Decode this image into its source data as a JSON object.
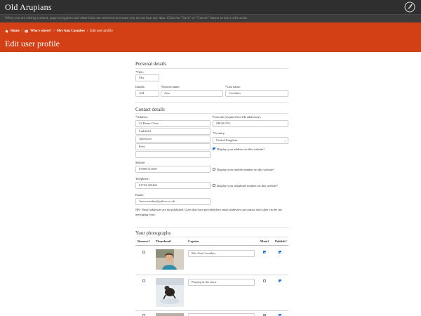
{
  "header": {
    "site_title": "Old Arupians",
    "logo_icon": "feather-quill-logo"
  },
  "notice": "When you are editing content, page navigation and other links are removed to ensure you do not lose any data. Click the \"Save\" or \"Cancel\" button to leave edit mode.",
  "breadcrumb": {
    "home": "Home",
    "whos_where": "Who's where?",
    "person": "Mrs Ann Coombes",
    "current": "Edit user profile",
    "separator": "/"
  },
  "page_title": "Edit user profile",
  "personal": {
    "heading": "Personal details",
    "title_label": "*Title:",
    "title_value": "Mrs",
    "initials_label": "Initials:",
    "initials_value": "AM",
    "known_label": "*Known name:",
    "known_value": "Ann",
    "last_label": "*Last name:",
    "last_value": "Coombes"
  },
  "contact": {
    "heading": "Contact details",
    "address_label": "*Address:",
    "address_lines": [
      "22 Baton Close",
      "Larkfield",
      "Aylesford",
      "Kent",
      ""
    ],
    "postcode_label": "Postcode (required for UK addresses):",
    "postcode_value": "ME20 6TG",
    "country_label": "*Country:",
    "country_value": "United Kingdom",
    "display_address_label": "Display your address on this website?",
    "mobile_label": "Mobile:",
    "mobile_value": "07890 511699",
    "display_mobile_label": "Display your mobile number on this website?",
    "telephone_label": "Telephone:",
    "telephone_value": "01732 369444",
    "display_telephone_label": "Display your telephone number on this website?",
    "email_label": "Email:",
    "email_value": "Ann.coombes@yahoo.co.uk",
    "email_note": "NB - Email addresses are not published. Users that have provided their email addresses can contact each other via the site messaging form."
  },
  "photos": {
    "heading": "Your photographs",
    "columns": [
      "Remove?",
      "Thumbnail",
      "Caption",
      "Main?",
      "Publish?"
    ],
    "rows": [
      {
        "caption": "Mrs Ann Coombes",
        "remove": false,
        "main": true,
        "publish": true
      },
      {
        "caption": "Playing in the snow",
        "remove": false,
        "main": false,
        "publish": true
      },
      {
        "caption": "",
        "remove": false,
        "main": false,
        "publish": true
      }
    ]
  },
  "colors": {
    "topbar": "#2f2f2f",
    "banner": "#d44015",
    "checkbox_checked": "#1b6fd8"
  }
}
